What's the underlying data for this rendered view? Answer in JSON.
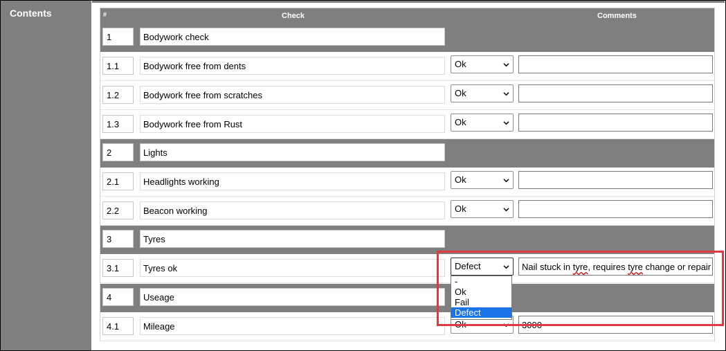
{
  "sidebar": {
    "label": "Contents"
  },
  "table": {
    "headers": {
      "num": "#",
      "check": "Check",
      "comments": "Comments"
    },
    "rows": [
      {
        "type": "section",
        "num": "1",
        "text": "Bodywork check"
      },
      {
        "type": "item",
        "num": "1.1",
        "text": "Bodywork free from dents",
        "status": "Ok",
        "comment": ""
      },
      {
        "type": "item",
        "num": "1.2",
        "text": "Bodywork free from scratches",
        "status": "Ok",
        "comment": ""
      },
      {
        "type": "item",
        "num": "1.3",
        "text": "Bodywork free from Rust",
        "status": "Ok",
        "comment": ""
      },
      {
        "type": "section",
        "num": "2",
        "text": "Lights"
      },
      {
        "type": "item",
        "num": "2.1",
        "text": "Headlights working",
        "status": "Ok",
        "comment": ""
      },
      {
        "type": "item",
        "num": "2.2",
        "text": "Beacon working",
        "status": "Ok",
        "comment": ""
      },
      {
        "type": "section",
        "num": "3",
        "text": "Tyres"
      },
      {
        "type": "item",
        "num": "3.1",
        "text": "Tyres ok",
        "status": "Defect",
        "comment_parts": [
          "Nail stuck in ",
          "tyre",
          ", requires ",
          "tyre",
          " change or repair"
        ]
      },
      {
        "type": "section",
        "num": "4",
        "text": "Useage"
      },
      {
        "type": "item",
        "num": "4.1",
        "text": "Mileage",
        "status": "Ok",
        "comment": "3000"
      }
    ]
  },
  "dropdown": {
    "options": [
      "-",
      "Ok",
      "Fail",
      "Defect"
    ],
    "selected": "Defect"
  },
  "colors": {
    "header_bg": "#7f7f7f",
    "highlight": "#e0393e",
    "selected_option": "#1a73e8"
  }
}
